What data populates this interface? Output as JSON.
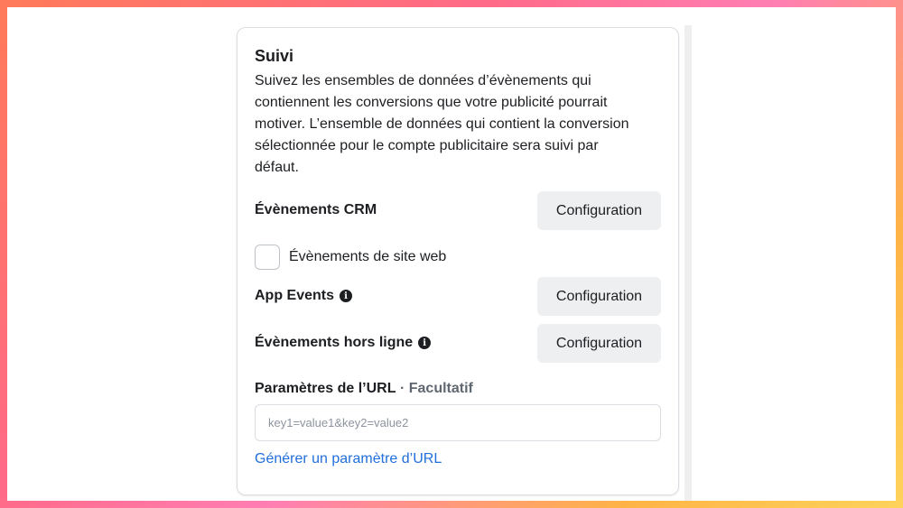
{
  "section": {
    "title": "Suivi",
    "description": "Suivez les ensembles de données d’évènements qui contiennent les conversions que votre publicité pourrait motiver. L’ensemble de données qui contient la conversion sélectionnée pour le compte publicitaire sera suivi par défaut."
  },
  "crm": {
    "label": "Évènements CRM",
    "button": "Configuration"
  },
  "website": {
    "label": "Évènements de site web",
    "checked": false
  },
  "app_events": {
    "label": "App Events",
    "button": "Configuration"
  },
  "offline": {
    "label": "Évènements hors ligne",
    "button": "Configuration"
  },
  "url_params": {
    "label": "Paramètres de l’URL",
    "optional": "· Facultatif",
    "placeholder": "key1=value1&key2=value2",
    "generate_link": "Générer un paramètre d’URL"
  },
  "icons": {
    "info": "info-icon"
  },
  "colors": {
    "link": "#216fdb",
    "button_bg": "#eeeff1",
    "text": "#1c1e21"
  }
}
